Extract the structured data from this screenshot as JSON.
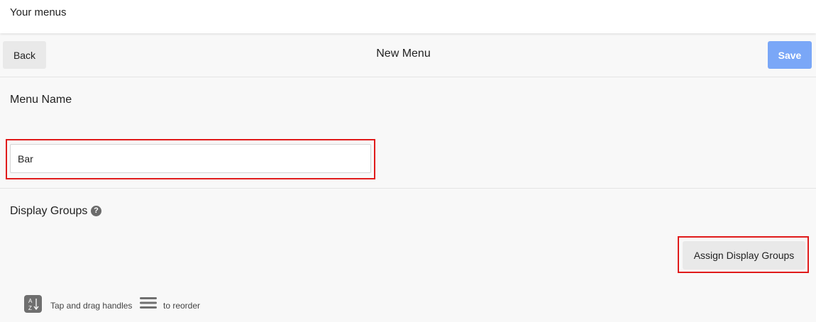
{
  "topbar": {
    "title": "Your menus"
  },
  "header": {
    "back_label": "Back",
    "page_title": "New Menu",
    "save_label": "Save"
  },
  "menu_name": {
    "label": "Menu Name",
    "value": "Bar"
  },
  "display_groups": {
    "label": "Display Groups",
    "help_icon_glyph": "?",
    "assign_button_label": "Assign Display Groups",
    "hint_prefix": "Tap and drag handles",
    "hint_suffix": "to reorder",
    "sort_icon": "az-sort-icon",
    "handle_icon": "drag-handle-icon"
  },
  "colors": {
    "save_button": "#7aa7f7",
    "highlight_border": "#e01b1b",
    "button_bg": "#e9e9e9",
    "page_bg": "#f8f8f8"
  }
}
